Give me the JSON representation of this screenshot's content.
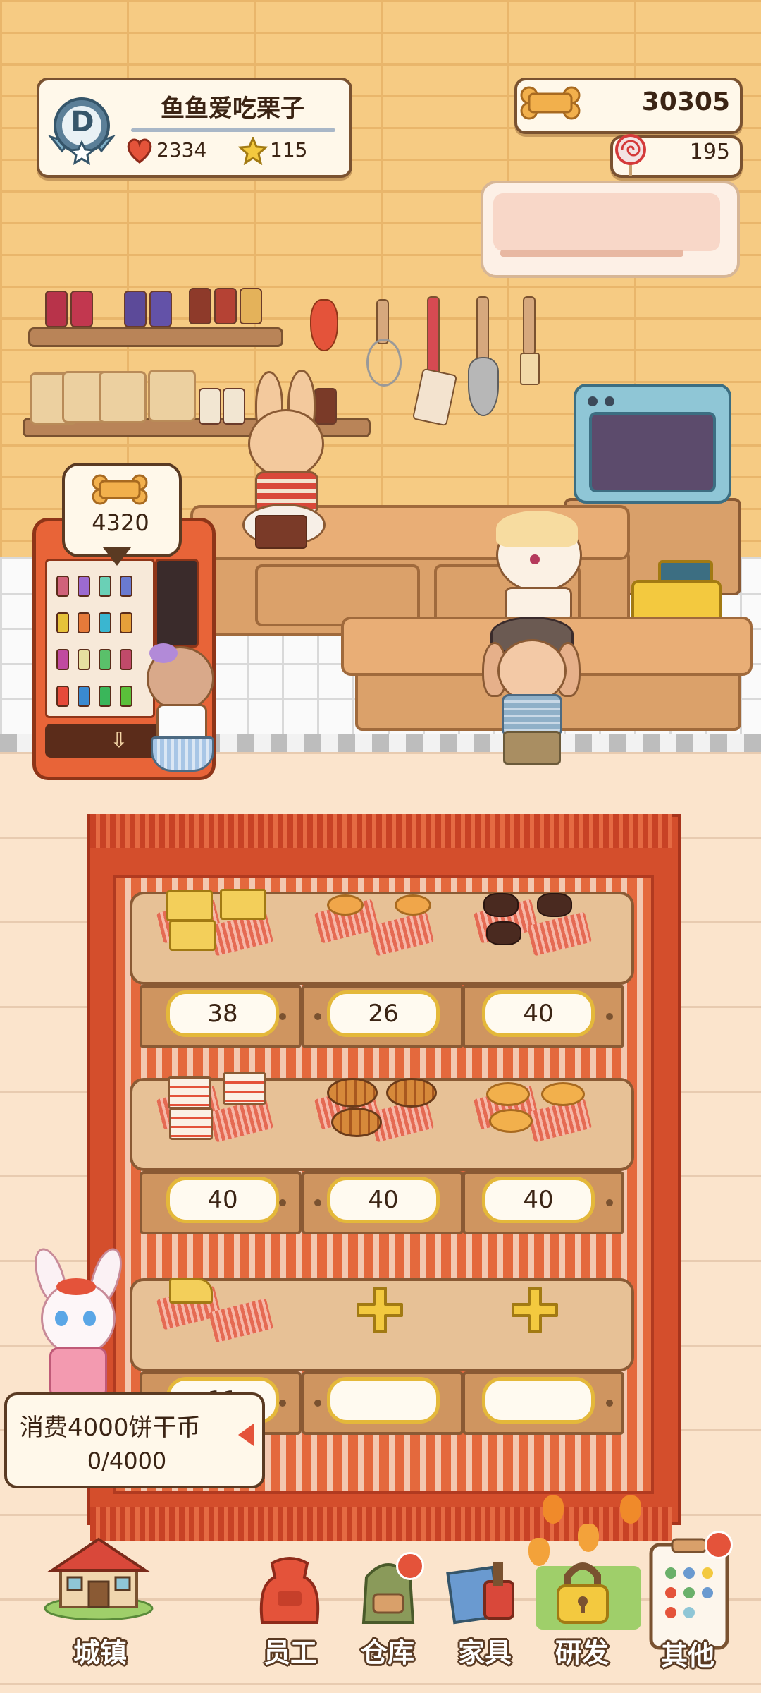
{
  "player": {
    "name": "鱼鱼爱吃栗子",
    "rank_letter": "D",
    "hearts": "2334",
    "stars": "115"
  },
  "currency": {
    "bones": "30305",
    "lollipops": "195"
  },
  "vending_bubble": {
    "value": "4320"
  },
  "display": {
    "row1": [
      "38",
      "26",
      "40"
    ],
    "row2": [
      "40",
      "40",
      "40"
    ],
    "row3": [
      "11",
      "",
      ""
    ]
  },
  "task": {
    "title": "消费4000饼干币",
    "progress": "0/4000"
  },
  "nav": {
    "town": "城镇",
    "staff": "员工",
    "warehouse": "仓库",
    "furniture": "家具",
    "research": "研发",
    "other": "其他"
  },
  "colors": {
    "accent_red": "#e4533a",
    "wood": "#8a5a34",
    "gold": "#e4b83a"
  }
}
